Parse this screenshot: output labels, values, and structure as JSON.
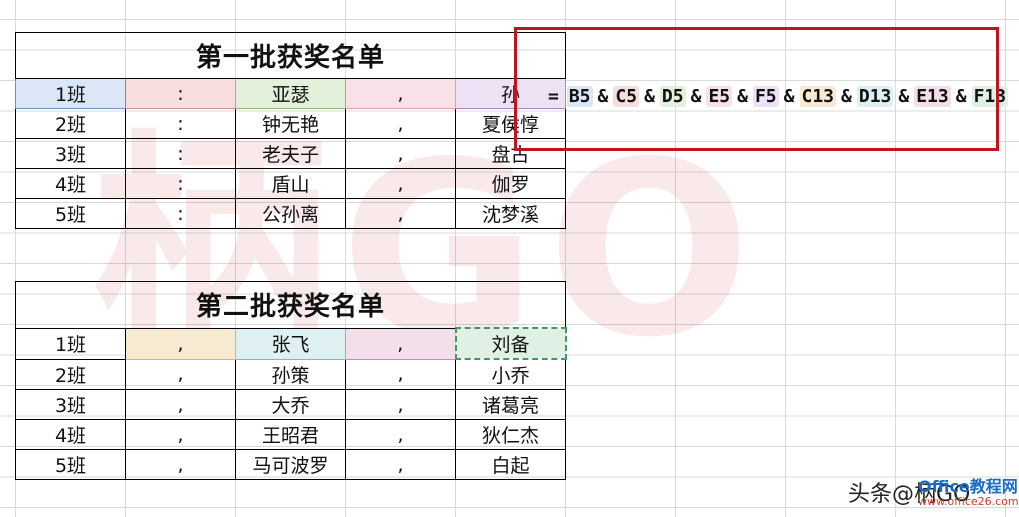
{
  "table1": {
    "title": "第一批获奖名单",
    "rows": [
      [
        "1班",
        ":",
        "亚瑟",
        ",",
        "孙"
      ],
      [
        "2班",
        ":",
        "钟无艳",
        ",",
        "夏侯惇"
      ],
      [
        "3班",
        ":",
        "老夫子",
        ",",
        "盘古"
      ],
      [
        "4班",
        ":",
        "盾山",
        ",",
        "伽罗"
      ],
      [
        "5班",
        ":",
        "公孙离",
        ",",
        "沈梦溪"
      ]
    ]
  },
  "table2": {
    "title": "第二批获奖名单",
    "rows": [
      [
        "1班",
        ",",
        "张飞",
        ",",
        "刘备"
      ],
      [
        "2班",
        ",",
        "孙策",
        ",",
        "小乔"
      ],
      [
        "3班",
        ",",
        "大乔",
        ",",
        "诸葛亮"
      ],
      [
        "4班",
        ",",
        "王昭君",
        ",",
        "狄仁杰"
      ],
      [
        "5班",
        ",",
        "马可波罗",
        ",",
        "白起"
      ]
    ]
  },
  "formula": {
    "eq": "=",
    "amp": "&",
    "refs": [
      "B5",
      "C5",
      "D5",
      "E5",
      "F5",
      "C13",
      "D13",
      "E13",
      "F13"
    ]
  },
  "watermark": {
    "text": "柄GO"
  },
  "footer": {
    "credit": "头条@柄GO",
    "logo_line1": "Office教程网",
    "logo_line2": "www.office26.com"
  },
  "colors": {
    "highlight_red": "#c0141e",
    "ref_B5": "#dbe7f7",
    "ref_C5": "#f6dedf",
    "ref_D5": "#e3f0dc",
    "ref_E5": "#f8e2e8",
    "ref_F5": "#ece2f3",
    "ref_C13": "#f6ead2",
    "ref_D13": "#dff0f3",
    "ref_E13": "#f3dfea",
    "ref_F13": "#dff0e4"
  }
}
